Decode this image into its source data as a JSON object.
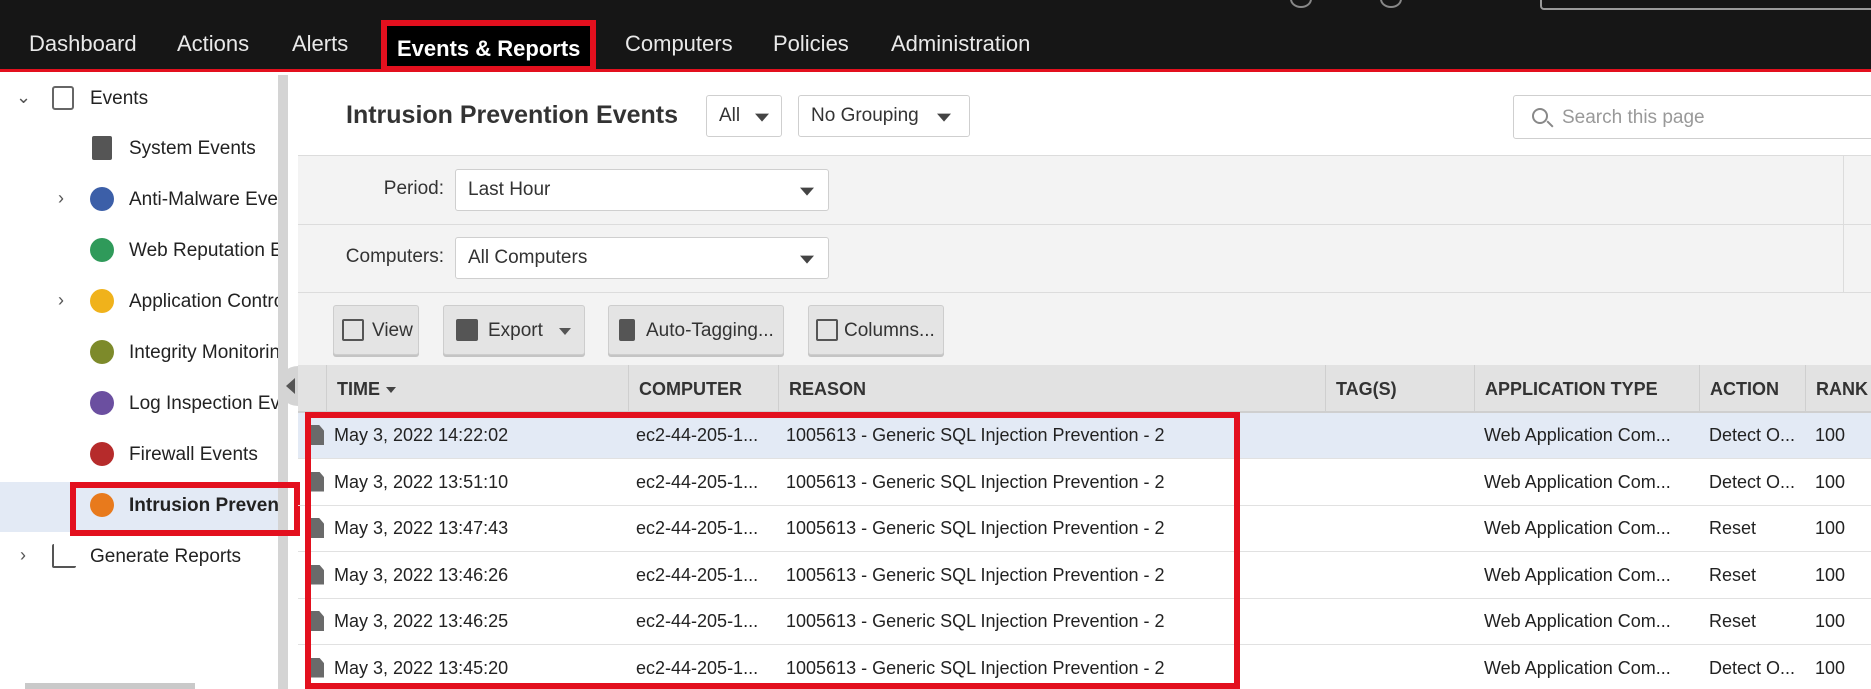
{
  "topnav": {
    "items": [
      "Dashboard",
      "Actions",
      "Alerts",
      "Events & Reports",
      "Computers",
      "Policies",
      "Administration"
    ],
    "active_index": 3
  },
  "sidebar": {
    "items": [
      {
        "label": "Events",
        "icon": "calendar-icon",
        "expand": "expanded"
      },
      {
        "label": "System Events",
        "icon": "server-icon"
      },
      {
        "label": "Anti-Malware Events",
        "icon": "biohazard-icon",
        "expand": "collapsed"
      },
      {
        "label": "Web Reputation Events",
        "icon": "web-reputation-icon"
      },
      {
        "label": "Application Control Events",
        "icon": "application-control-icon",
        "expand": "collapsed"
      },
      {
        "label": "Integrity Monitoring Events",
        "icon": "fingerprint-icon"
      },
      {
        "label": "Log Inspection Events",
        "icon": "magnifier-icon"
      },
      {
        "label": "Firewall Events",
        "icon": "firewall-icon"
      },
      {
        "label": "Intrusion Prevention Events",
        "icon": "intrusion-prevention-icon"
      },
      {
        "label": "Generate Reports",
        "icon": "report-chart-icon",
        "expand": "collapsed"
      }
    ],
    "selected_index": 8
  },
  "main": {
    "title": "Intrusion Prevention Events",
    "filter_scope": "All",
    "grouping": "No Grouping",
    "search_placeholder": "Search this page",
    "period_label": "Period:",
    "period_value": "Last Hour",
    "computers_label": "Computers:",
    "computers_value": "All Computers",
    "toolbar": {
      "view": "View",
      "export": "Export",
      "auto_tagging": "Auto-Tagging...",
      "columns": "Columns..."
    }
  },
  "table": {
    "columns": [
      "TIME",
      "COMPUTER",
      "REASON",
      "TAG(S)",
      "APPLICATION TYPE",
      "ACTION",
      "RANK"
    ],
    "sorted_column": "TIME",
    "rows": [
      {
        "time": "May 3, 2022 14:22:02",
        "computer": "ec2-44-205-1...",
        "reason": "1005613 - Generic SQL Injection Prevention - 2",
        "tags": "",
        "app_type": "Web Application Com...",
        "action": "Detect O...",
        "rank": "100"
      },
      {
        "time": "May 3, 2022 13:51:10",
        "computer": "ec2-44-205-1...",
        "reason": "1005613 - Generic SQL Injection Prevention - 2",
        "tags": "",
        "app_type": "Web Application Com...",
        "action": "Detect O...",
        "rank": "100"
      },
      {
        "time": "May 3, 2022 13:47:43",
        "computer": "ec2-44-205-1...",
        "reason": "1005613 - Generic SQL Injection Prevention - 2",
        "tags": "",
        "app_type": "Web Application Com...",
        "action": "Reset",
        "rank": "100"
      },
      {
        "time": "May 3, 2022 13:46:26",
        "computer": "ec2-44-205-1...",
        "reason": "1005613 - Generic SQL Injection Prevention - 2",
        "tags": "",
        "app_type": "Web Application Com...",
        "action": "Reset",
        "rank": "100"
      },
      {
        "time": "May 3, 2022 13:46:25",
        "computer": "ec2-44-205-1...",
        "reason": "1005613 - Generic SQL Injection Prevention - 2",
        "tags": "",
        "app_type": "Web Application Com...",
        "action": "Reset",
        "rank": "100"
      },
      {
        "time": "May 3, 2022 13:45:20",
        "computer": "ec2-44-205-1...",
        "reason": "1005613 - Generic SQL Injection Prevention - 2",
        "tags": "",
        "app_type": "Web Application Com...",
        "action": "Detect O...",
        "rank": "100"
      }
    ],
    "selected_row": 0
  },
  "colors": {
    "nav_bg": "#161616",
    "highlight_red": "#e3101e",
    "selection_blue": "#e3eaf5",
    "toolbar_gray": "#f3f3f3"
  }
}
